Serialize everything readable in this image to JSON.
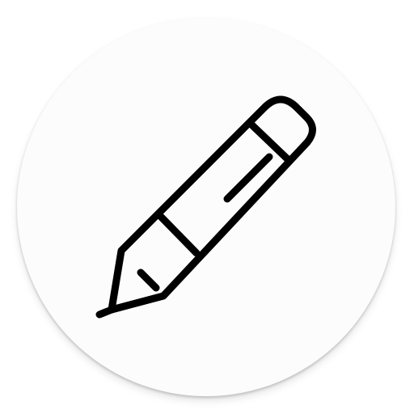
{
  "app_icon": {
    "icon": "pencil-icon",
    "colors": {
      "badge_fill": "#fcfcfc",
      "stroke": "#000000",
      "page_background": "#ffffff"
    }
  }
}
